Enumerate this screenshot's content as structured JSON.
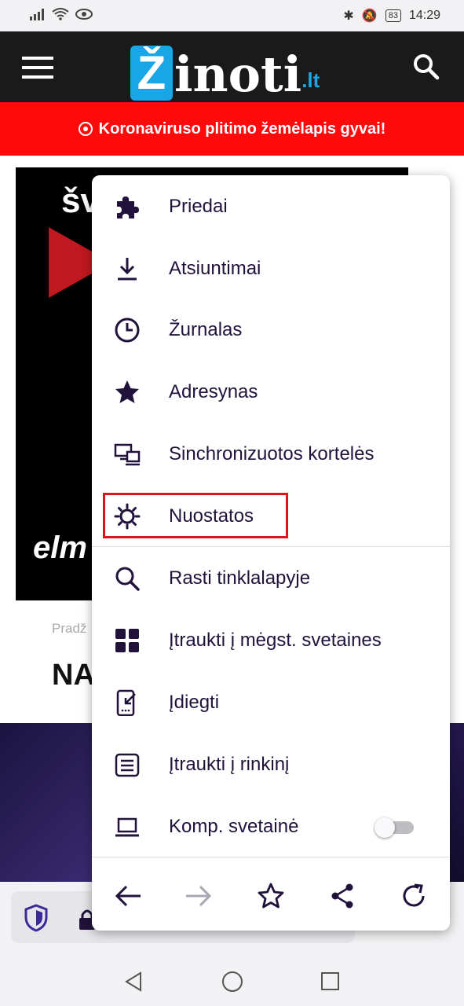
{
  "status_bar": {
    "battery": "83",
    "time": "14:29"
  },
  "header": {
    "logo_letter": "Ž",
    "logo_text": "inoti",
    "logo_suffix": ".lt"
  },
  "banner": {
    "text": "Koronaviruso plitimo žemėlapis gyvai!"
  },
  "page": {
    "ad_text_top": "šv",
    "ad_text_logo": "elm",
    "breadcrumb": "Pradž",
    "headline": "NA"
  },
  "menu": {
    "items": [
      {
        "label": "Priedai",
        "icon": "puzzle-icon"
      },
      {
        "label": "Atsiuntimai",
        "icon": "download-icon"
      },
      {
        "label": "Žurnalas",
        "icon": "clock-icon"
      },
      {
        "label": "Adresynas",
        "icon": "star-icon"
      },
      {
        "label": "Sinchronizuotos kortelės",
        "icon": "synced-tabs-icon"
      },
      {
        "label": "Nuostatos",
        "icon": "gear-icon"
      },
      {
        "label": "Rasti tinklalapyje",
        "icon": "search-icon"
      },
      {
        "label": "Įtraukti į mėgst. svetaines",
        "icon": "grid-icon"
      },
      {
        "label": "Įdiegti",
        "icon": "install-icon"
      },
      {
        "label": "Įtraukti į rinkinį",
        "icon": "collection-icon"
      },
      {
        "label": "Komp. svetainė",
        "icon": "laptop-icon"
      }
    ],
    "desktop_site_enabled": false,
    "highlighted_item": "Nuostatos",
    "highlight_color": "#e0121d"
  },
  "colors": {
    "header_bg": "#1a1a1a",
    "banner_bg": "#ff0a0a",
    "logo_blue": "#18a6e6",
    "menu_text": "#20123a"
  }
}
